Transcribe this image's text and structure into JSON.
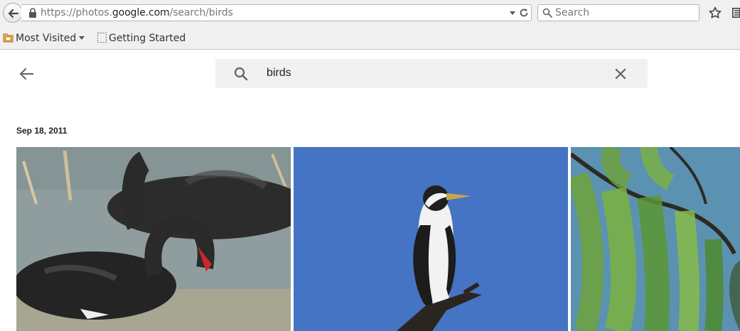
{
  "browser": {
    "url": {
      "prefix": "https://photos.",
      "host": "google.com",
      "path": "/search/birds"
    },
    "search_placeholder": "Search",
    "bookmarks": [
      {
        "label": "Most Visited",
        "icon": "folder-icon",
        "has_dropdown": true
      },
      {
        "label": "Getting Started",
        "icon": "page-icon",
        "has_dropdown": false
      }
    ]
  },
  "photos_search": {
    "query": "birds"
  },
  "results": {
    "groups": [
      {
        "date": "Sep 18, 2011",
        "photos": [
          {
            "subject": "black-swans"
          },
          {
            "subject": "cormorant"
          },
          {
            "subject": "willow-tree"
          }
        ]
      }
    ]
  },
  "colors": {
    "chrome_bg": "#f0f0f0",
    "search_bg": "#f1f1f1",
    "text_primary": "#202124",
    "icon_grey": "#5f6368"
  }
}
